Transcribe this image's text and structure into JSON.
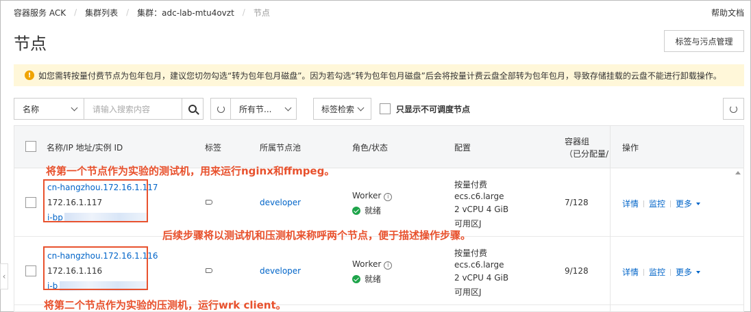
{
  "breadcrumb": [
    "容器服务 ACK",
    "集群列表",
    "集群：adc-lab-mtu4ovzt",
    "节点"
  ],
  "help_docs": "帮助文档",
  "page_title": "节点",
  "tag_mgmt_button": "标签与污点管理",
  "notice": "如您需转按量付费节点为包年包月，建议您切勿勾选“转为包年包月磁盘”。因为若勾选“转为包年包月磁盘”后会将按量计费云盘全部转为包年包月，导致存储挂载的云盘不能进行卸载操作。",
  "toolbar": {
    "name_select": "名称",
    "search_placeholder": "请输入搜索内容",
    "pool_select": "所有节...",
    "tag_search": "标签检索",
    "only_unschedulable": "只显示不可调度节点"
  },
  "columns": {
    "name": "名称/IP 地址/实例 ID",
    "tags": "标签",
    "pool": "所属节点池",
    "role": "角色/状态",
    "config": "配置",
    "pods_line1": "容器组",
    "pods_line2": "（已分配量/",
    "ops": "操作"
  },
  "rows": [
    {
      "name": "cn-hangzhou.172.16.1.117",
      "ip": "172.16.1.117",
      "instance_prefix": "i-bp",
      "pool": "developer",
      "role": "Worker",
      "status": "就绪",
      "billing": "按量付费",
      "instance_type": "ecs.c6.large",
      "spec": "2 vCPU 4 GiB",
      "zone": "可用区J",
      "pods": "7/128"
    },
    {
      "name": "cn-hangzhou.172.16.1.116",
      "ip": "172.16.1.116",
      "instance_prefix": "i-b",
      "pool": "developer",
      "role": "Worker",
      "status": "就绪",
      "billing": "按量付费",
      "instance_type": "ecs.c6.large",
      "spec": "2 vCPU 4 GiB",
      "zone": "可用区J",
      "pods": "9/128"
    }
  ],
  "ops": {
    "details": "详情",
    "monitor": "监控",
    "more": "更多"
  },
  "annotations": {
    "a1": "将第一个节点作为实验的测试机，用来运行nginx和ffmpeg。",
    "a2": "后续步骤将以测试机和压测机来称呼两个节点，便于描述操作步骤。",
    "a3": "将第二个节点作为实验的压测机，运行wrk client。"
  },
  "colors": {
    "link": "#0064c8",
    "annotation": "#e8512d",
    "notice_bg": "#fff7d9",
    "ok": "#1ea44a"
  }
}
